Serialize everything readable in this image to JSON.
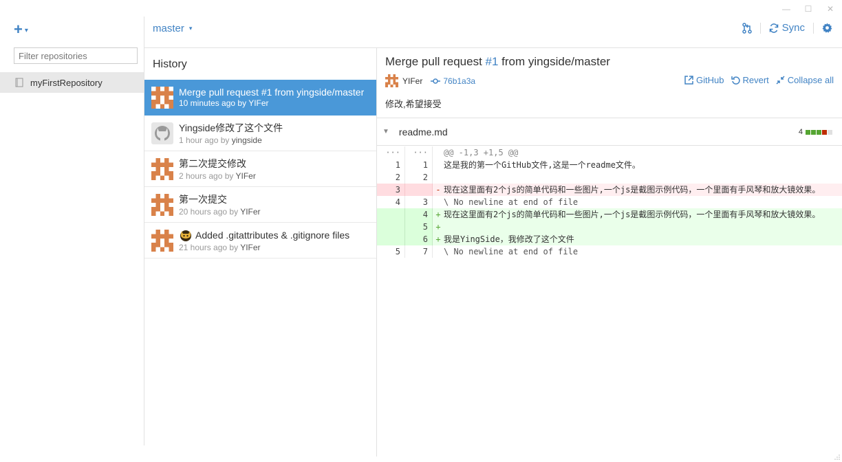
{
  "window": {
    "minimize": "—",
    "maximize": "☐",
    "close": "✕"
  },
  "sidebar": {
    "add_label": "+",
    "add_caret": "▾",
    "filter_placeholder": "Filter repositories",
    "repos": [
      {
        "name": "myFirstRepository"
      }
    ]
  },
  "topbar": {
    "branch": "master",
    "branch_caret": "▾",
    "sync_label": "Sync"
  },
  "history": {
    "title": "History",
    "commits": [
      {
        "message": "Merge pull request #1 from yingside/master",
        "time": "10 minutes ago by",
        "author": "YIFer",
        "avatar": "identicon-orange",
        "selected": true
      },
      {
        "message": "Yingside修改了这个文件",
        "time": "1 hour ago by",
        "author": "yingside",
        "avatar": "github-octocat"
      },
      {
        "message": "第二次提交修改",
        "time": "2 hours ago by",
        "author": "YIFer",
        "avatar": "identicon-orange"
      },
      {
        "message": "第一次提交",
        "time": "20 hours ago by",
        "author": "YIFer",
        "avatar": "identicon-orange"
      },
      {
        "message": "Added .gitattributes & .gitignore files",
        "time": "21 hours ago by",
        "author": "YIFer",
        "avatar": "identicon-orange",
        "emoji": "octocat-emoji"
      }
    ]
  },
  "detail": {
    "title_prefix": "Merge pull request ",
    "title_pr": "#1",
    "title_suffix": " from yingside/master",
    "author": "YIFer",
    "sha": "76b1a3a",
    "actions": {
      "github": "GitHub",
      "revert": "Revert",
      "collapse": "Collapse all"
    },
    "description": "修改,希望接受"
  },
  "file": {
    "name": "readme.md",
    "change_count": "4",
    "stat_colors": [
      "#55a532",
      "#55a532",
      "#55a532",
      "#bd2c00",
      "#e0e0e0"
    ]
  },
  "diff": {
    "lines": [
      {
        "type": "hunk",
        "old": "···",
        "new": "···",
        "sign": "",
        "code": "@@ -1,3 +1,5 @@"
      },
      {
        "type": "ctx",
        "old": "1",
        "new": "1",
        "sign": "",
        "code": "这是我的第一个GitHub文件,这是一个readme文件。"
      },
      {
        "type": "ctx",
        "old": "2",
        "new": "2",
        "sign": "",
        "code": ""
      },
      {
        "type": "del",
        "old": "3",
        "new": "",
        "sign": "-",
        "code": "现在这里面有2个js的简单代码和一些图片,一个js是截图示例代码，一个里面有手风琴和放大镜效果。"
      },
      {
        "type": "ctx nonl",
        "old": "4",
        "new": "3",
        "sign": "",
        "code": "\\ No newline at end of file"
      },
      {
        "type": "add",
        "old": "",
        "new": "4",
        "sign": "+",
        "code": "现在这里面有2个js的简单代码和一些图片,一个js是截图示例代码，一个里面有手风琴和放大镜效果。"
      },
      {
        "type": "add",
        "old": "",
        "new": "5",
        "sign": "+",
        "code": ""
      },
      {
        "type": "add",
        "old": "",
        "new": "6",
        "sign": "+",
        "code": "我是YingSide，我修改了这个文件"
      },
      {
        "type": "ctx nonl",
        "old": "5",
        "new": "7",
        "sign": "",
        "code": "\\ No newline at end of file"
      }
    ]
  },
  "colors": {
    "accent": "#4183c4",
    "selected": "#4a98d8",
    "avatar": "#d9824a"
  }
}
